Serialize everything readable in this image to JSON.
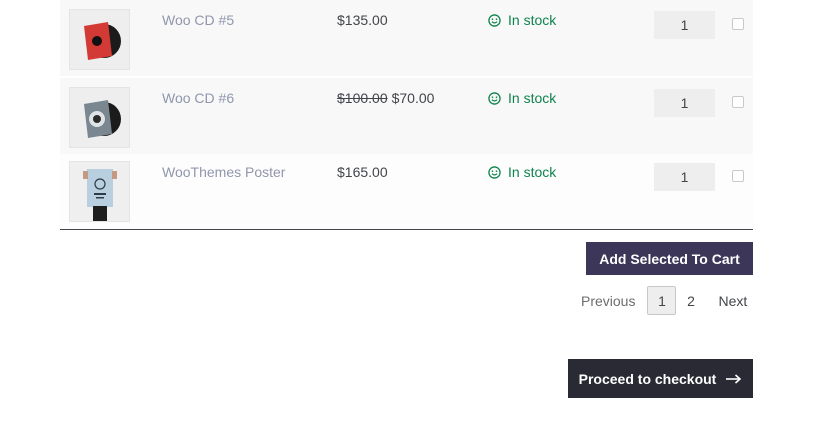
{
  "products": [
    {
      "name": "Woo CD #5",
      "price_old": "",
      "price": "$135.00",
      "stock": "In stock",
      "qty": "1",
      "thumb_icon": "cd-red-icon",
      "thumb_color": "#d43a35"
    },
    {
      "name": "Woo CD #6",
      "price_old": "$100.00",
      "price": "$70.00",
      "stock": "In stock",
      "qty": "1",
      "thumb_icon": "cd-grey-icon",
      "thumb_color": "#7a8690"
    },
    {
      "name": "WooThemes Poster",
      "price_old": "",
      "price": "$165.00",
      "stock": "In stock",
      "qty": "1",
      "thumb_icon": "poster-icon",
      "thumb_color": "#b8cfe0"
    }
  ],
  "actions": {
    "add_selected": "Add Selected To Cart",
    "checkout": "Proceed to checkout"
  },
  "pagination": {
    "previous": "Previous",
    "pages": [
      "1",
      "2"
    ],
    "current": "1",
    "next": "Next"
  },
  "colors": {
    "stock": "#0f834d",
    "add_button": "#3c3658",
    "checkout_button": "#2a2a35",
    "product_link": "#8f97ad"
  }
}
